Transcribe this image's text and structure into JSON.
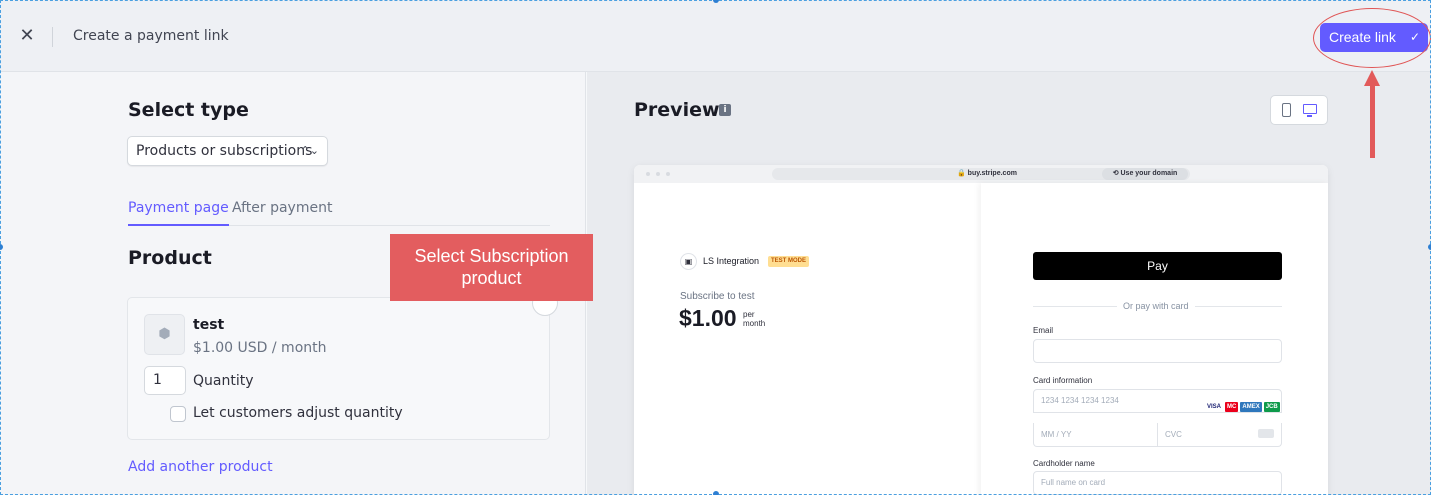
{
  "header": {
    "close_icon": "close-icon",
    "title": "Create a payment link",
    "create_label": "Create link",
    "create_icon": "check-icon"
  },
  "left": {
    "select_type_title": "Select type",
    "type_value": "Products or subscriptions",
    "tabs": [
      {
        "label": "Payment page",
        "active": true
      },
      {
        "label": "After payment",
        "active": false
      }
    ],
    "product_title": "Product",
    "product": {
      "name": "test",
      "price": "$1.00 USD / month",
      "quantity": "1",
      "quantity_label": "Quantity",
      "adjust_label": "Let customers adjust quantity",
      "adjust_checked": false
    },
    "add_product_label": "Add another product"
  },
  "annotation": {
    "callout_text": "Select Subscription product",
    "color": "#e35d5f"
  },
  "preview": {
    "title": "Preview",
    "browser": {
      "address": "buy.stripe.com",
      "domain_pill": "Use your domain"
    },
    "checkout": {
      "business_name": "LS Integration",
      "mode_badge": "TEST MODE",
      "subscribe_label": "Subscribe to test",
      "amount": "$1.00",
      "period_line1": "per",
      "period_line2": "month",
      "apple_pay_label": "Pay",
      "or_text": "Or pay with card",
      "email_label": "Email",
      "card_label": "Card information",
      "card_placeholder": "1234 1234 1234 1234",
      "expiry_placeholder": "MM / YY",
      "cvc_placeholder": "CVC",
      "cardholder_label": "Cardholder name",
      "cardholder_placeholder": "Full name on card",
      "card_brands": [
        "VISA",
        "MC",
        "AMEX",
        "JCB"
      ]
    }
  },
  "colors": {
    "accent": "#635bff",
    "annotation_red": "#e25a5a"
  }
}
